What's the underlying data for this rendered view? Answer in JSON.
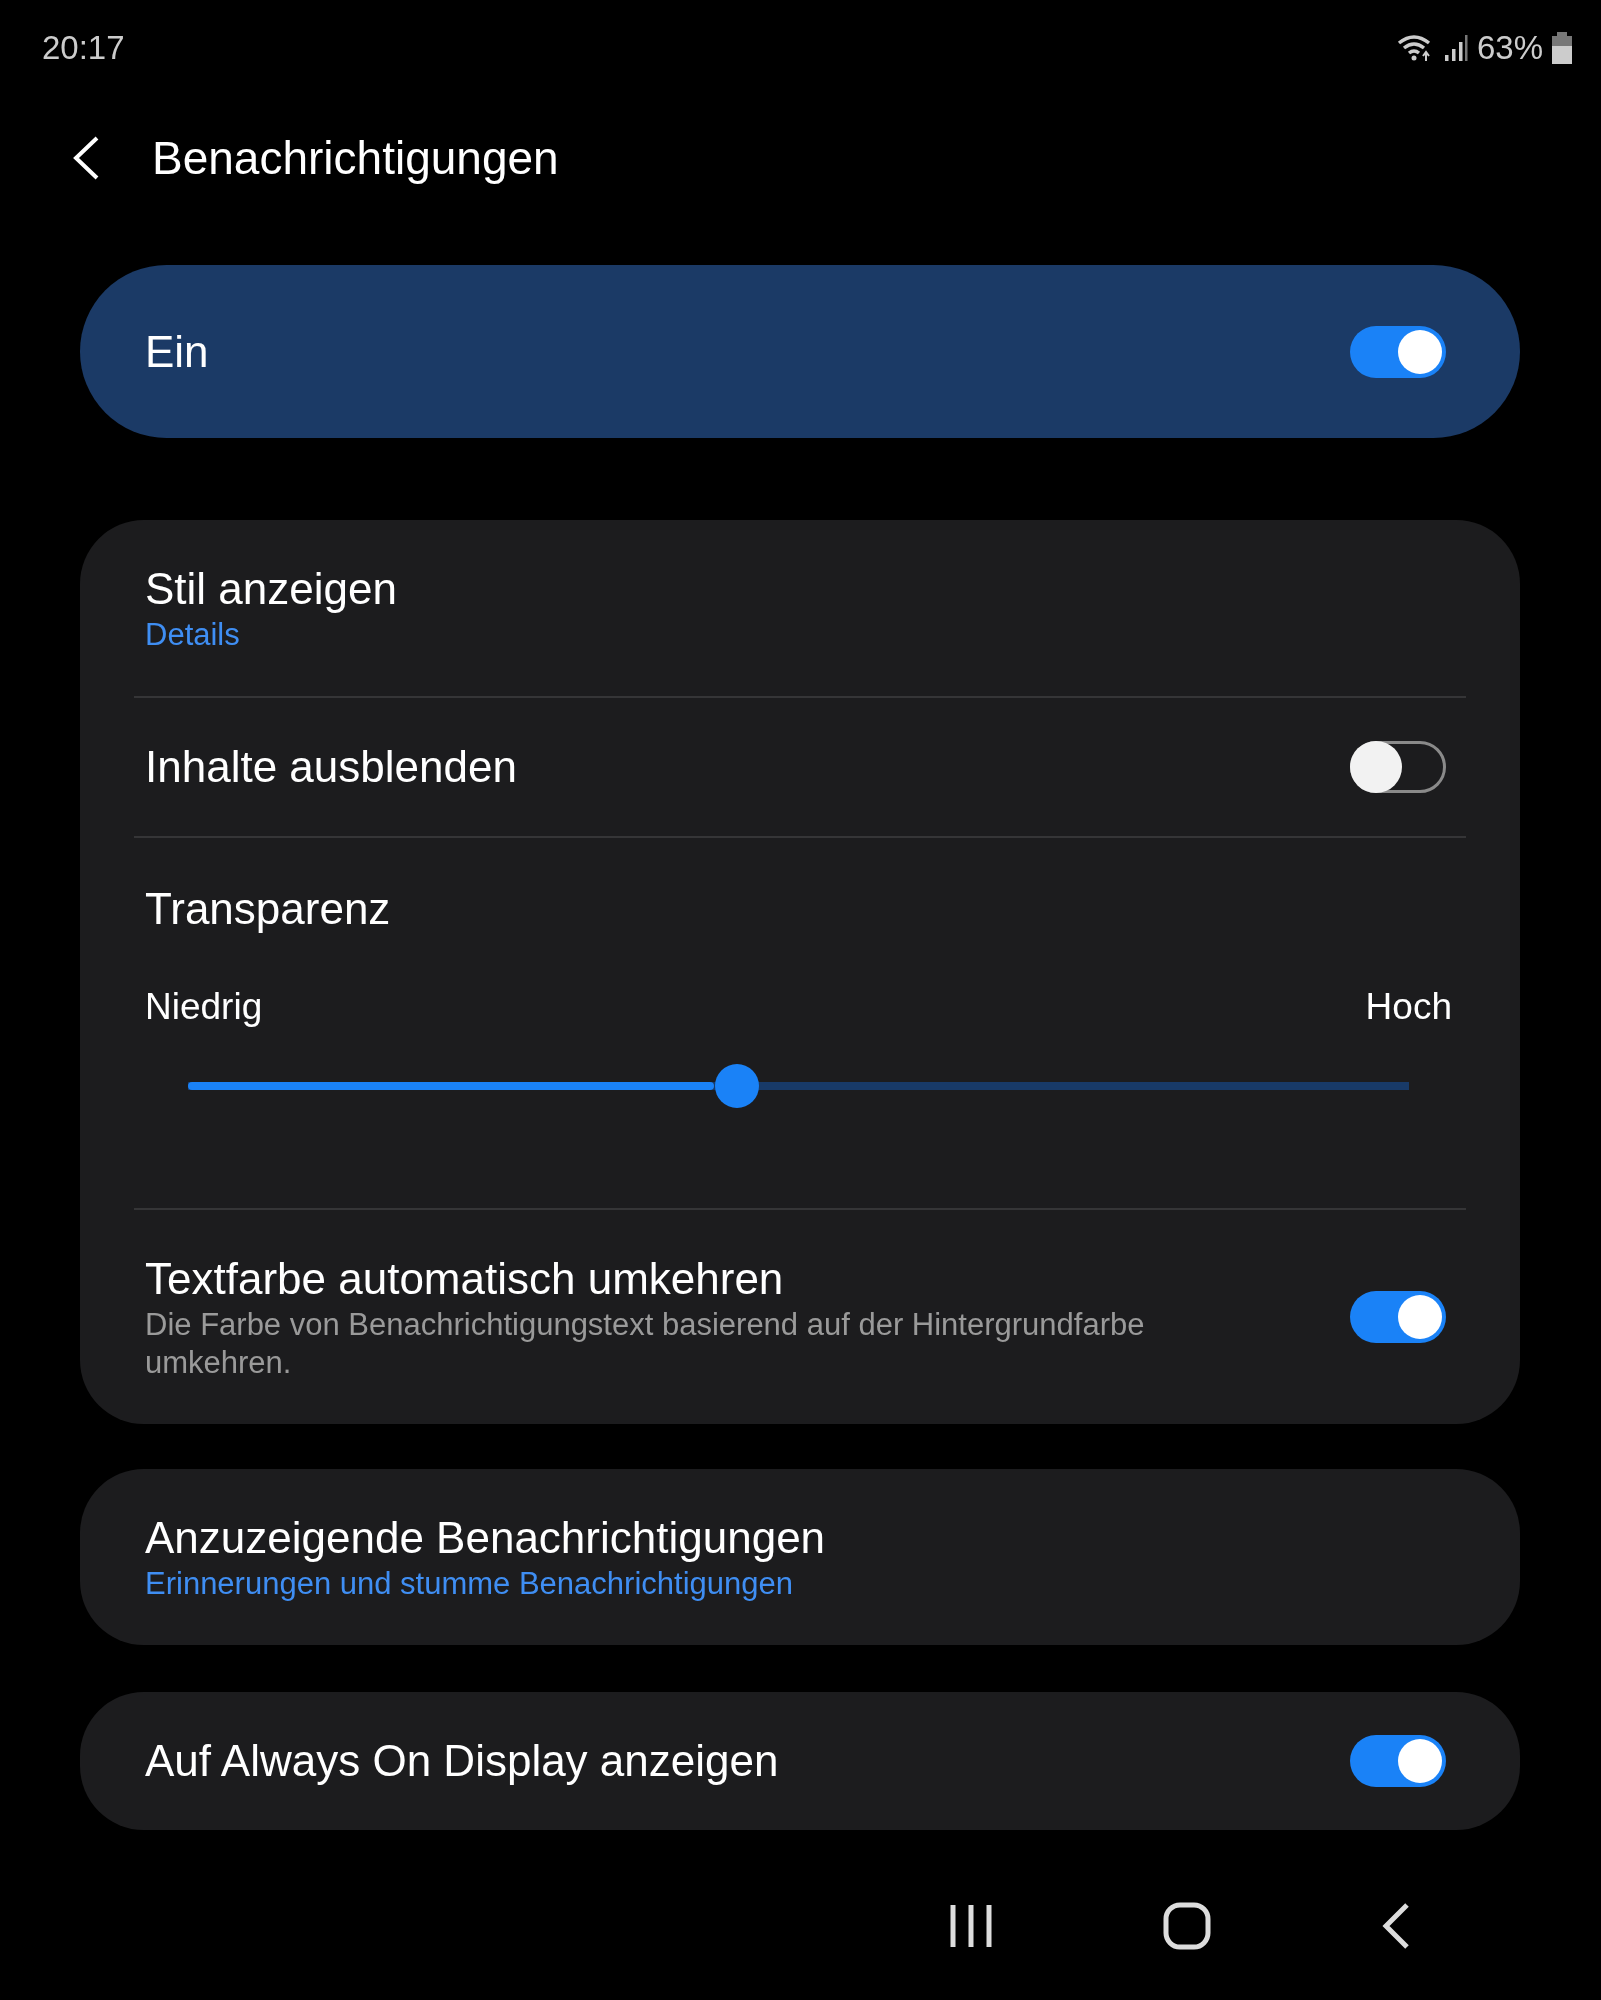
{
  "status_bar": {
    "time": "20:17",
    "battery": "63%"
  },
  "header": {
    "title": "Benachrichtigungen"
  },
  "master": {
    "label": "Ein",
    "on": true
  },
  "groups": [
    {
      "items": [
        {
          "kind": "link",
          "title": "Stil anzeigen",
          "summary": "Details"
        },
        {
          "kind": "switch",
          "title": "Inhalte ausblenden",
          "on": false
        },
        {
          "kind": "slider",
          "title": "Transparenz",
          "min_label": "Niedrig",
          "max_label": "Hoch",
          "level": 0.45
        },
        {
          "kind": "switch",
          "title": "Textfarbe automatisch umkehren",
          "summary": "Die Farbe von Benachrichtigungstext basierend auf der Hintergrundfarbe umkehren.",
          "on": true
        }
      ]
    },
    {
      "items": [
        {
          "kind": "link",
          "title": "Anzuzeigende Benachrichtigungen",
          "summary": "Erinnerungen und stumme Benachrichtigungen"
        }
      ]
    },
    {
      "items": [
        {
          "kind": "switch",
          "title": "Auf Always On Display anzeigen",
          "on": true
        }
      ]
    }
  ]
}
